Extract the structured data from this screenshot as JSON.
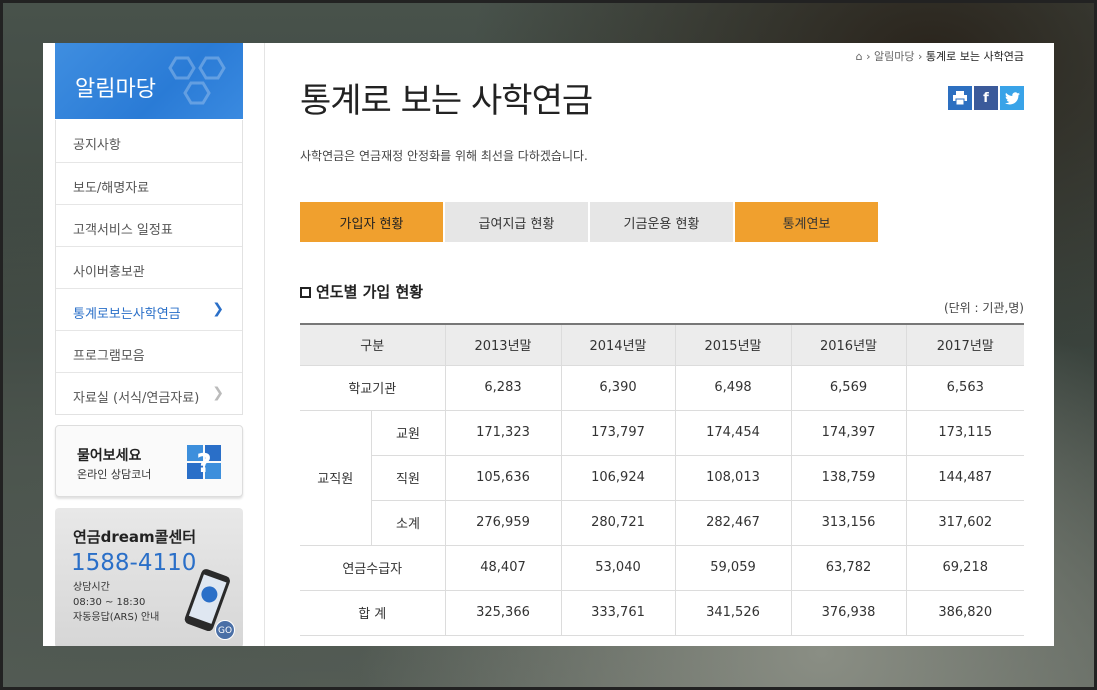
{
  "sidebar": {
    "title": "알림마당",
    "items": [
      {
        "label": "공지사항"
      },
      {
        "label": "보도/해명자료"
      },
      {
        "label": "고객서비스 일정표"
      },
      {
        "label": "사이버홍보관"
      },
      {
        "label": "통계로보는사학연금"
      },
      {
        "label": "프로그램모음"
      },
      {
        "label": "자료실 (서식/연금자료)"
      }
    ],
    "ask": {
      "title": "물어보세요",
      "subtitle": "온라인 상담코너"
    },
    "call": {
      "title": "연금dream콜센터",
      "number": "1588-4110",
      "hours_label": "상담시간",
      "hours": "08:30 ~ 18:30",
      "ars": "자동응답(ARS) 안내",
      "go": "GO"
    }
  },
  "breadcrumb": {
    "home_icon": "⌂",
    "parent": "알림마당",
    "current": "통계로 보는 사학연금"
  },
  "page": {
    "title": "통계로 보는 사학연금",
    "description": "사학연금은 연금재정 안정화를 위해 최선을 다하겠습니다."
  },
  "share": {
    "print": "print-icon",
    "facebook": "f",
    "twitter": "twitter-icon"
  },
  "tabs": [
    {
      "label": "가입자 현황",
      "active": true
    },
    {
      "label": "급여지급 현황",
      "active": false
    },
    {
      "label": "기금운용 현황",
      "active": false
    },
    {
      "label": "통계연보",
      "active": false
    }
  ],
  "section": {
    "title": "연도별 가입 현황",
    "unit": "(단위 : 기관,명)"
  },
  "table": {
    "header": {
      "col0": "구분",
      "years": [
        "2013년말",
        "2014년말",
        "2015년말",
        "2016년말",
        "2017년말"
      ]
    },
    "school": {
      "label": "학교기관",
      "values": [
        "6,283",
        "6,390",
        "6,498",
        "6,569",
        "6,563"
      ]
    },
    "staff_group": "교직원",
    "teacher": {
      "label": "교원",
      "values": [
        "171,323",
        "173,797",
        "174,454",
        "174,397",
        "173,115"
      ]
    },
    "worker": {
      "label": "직원",
      "values": [
        "105,636",
        "106,924",
        "108,013",
        "138,759",
        "144,487"
      ]
    },
    "subtotal": {
      "label": "소계",
      "values": [
        "276,959",
        "280,721",
        "282,467",
        "313,156",
        "317,602"
      ]
    },
    "pensioner": {
      "label": "연금수급자",
      "values": [
        "48,407",
        "53,040",
        "59,059",
        "63,782",
        "69,218"
      ]
    },
    "total": {
      "label": "합 계",
      "values": [
        "325,366",
        "333,761",
        "341,526",
        "376,938",
        "386,820"
      ]
    }
  }
}
